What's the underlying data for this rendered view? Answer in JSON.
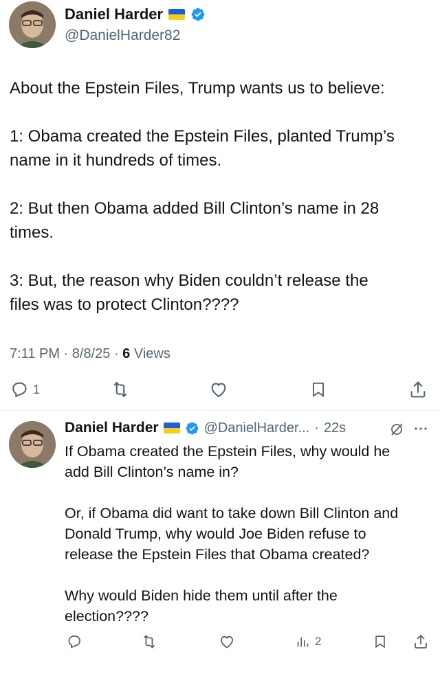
{
  "main_tweet": {
    "author_name": "Daniel Harder",
    "author_handle": "@DanielHarder82",
    "text_paragraphs": [
      [
        "About the Epstein Files, Trump wants us to believe:"
      ],
      [
        "1: Obama created the Epstein Files, planted Trump’s",
        "name in it hundreds of times."
      ],
      [
        "2: But then Obama added Bill Clinton’s name in 28",
        "times."
      ],
      [
        "3: But, the reason why Biden couldn’t release the",
        "files was to protect Clinton????"
      ]
    ],
    "time": "7:11 PM",
    "date": "8/8/25",
    "views_count": "6",
    "views_label": "Views",
    "reply_count": "1"
  },
  "reply_tweet": {
    "author_name": "Daniel Harder",
    "author_handle": "@DanielHarder...",
    "time_ago": "22s",
    "lines": [
      "If Obama created the Epstein Files, why would he",
      "add Bill Clinton’s name in?",
      "",
      "Or, if Obama did want to take down Bill Clinton and",
      "Donald Trump, why would Joe Biden refuse to",
      "release the Epstein Files that Obama created?",
      "",
      "Why would Biden hide them until after the",
      "election????"
    ],
    "views_count": "2"
  },
  "icons": {
    "verified": "verified-badge-icon",
    "flag": "ukraine-flag-icon",
    "reply": "reply-icon",
    "retweet": "retweet-icon",
    "like": "like-icon",
    "bookmark": "bookmark-icon",
    "share": "share-icon",
    "views": "views-icon",
    "grok": "grok-icon",
    "more": "more-icon"
  },
  "colors": {
    "verified_blue": "#1d9bf0",
    "text": "#0f1419",
    "secondary": "#536471",
    "flag_blue": "#1f5fd6",
    "flag_yellow": "#f4cf21"
  }
}
